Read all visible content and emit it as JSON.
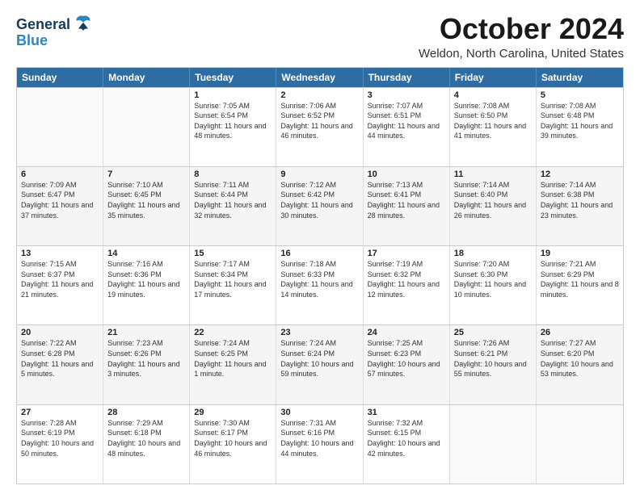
{
  "header": {
    "logo_line1": "General",
    "logo_line2": "Blue",
    "month": "October 2024",
    "location": "Weldon, North Carolina, United States"
  },
  "days_of_week": [
    "Sunday",
    "Monday",
    "Tuesday",
    "Wednesday",
    "Thursday",
    "Friday",
    "Saturday"
  ],
  "weeks": [
    [
      {
        "day": "",
        "text": ""
      },
      {
        "day": "",
        "text": ""
      },
      {
        "day": "1",
        "text": "Sunrise: 7:05 AM\nSunset: 6:54 PM\nDaylight: 11 hours and 48 minutes."
      },
      {
        "day": "2",
        "text": "Sunrise: 7:06 AM\nSunset: 6:52 PM\nDaylight: 11 hours and 46 minutes."
      },
      {
        "day": "3",
        "text": "Sunrise: 7:07 AM\nSunset: 6:51 PM\nDaylight: 11 hours and 44 minutes."
      },
      {
        "day": "4",
        "text": "Sunrise: 7:08 AM\nSunset: 6:50 PM\nDaylight: 11 hours and 41 minutes."
      },
      {
        "day": "5",
        "text": "Sunrise: 7:08 AM\nSunset: 6:48 PM\nDaylight: 11 hours and 39 minutes."
      }
    ],
    [
      {
        "day": "6",
        "text": "Sunrise: 7:09 AM\nSunset: 6:47 PM\nDaylight: 11 hours and 37 minutes."
      },
      {
        "day": "7",
        "text": "Sunrise: 7:10 AM\nSunset: 6:45 PM\nDaylight: 11 hours and 35 minutes."
      },
      {
        "day": "8",
        "text": "Sunrise: 7:11 AM\nSunset: 6:44 PM\nDaylight: 11 hours and 32 minutes."
      },
      {
        "day": "9",
        "text": "Sunrise: 7:12 AM\nSunset: 6:42 PM\nDaylight: 11 hours and 30 minutes."
      },
      {
        "day": "10",
        "text": "Sunrise: 7:13 AM\nSunset: 6:41 PM\nDaylight: 11 hours and 28 minutes."
      },
      {
        "day": "11",
        "text": "Sunrise: 7:14 AM\nSunset: 6:40 PM\nDaylight: 11 hours and 26 minutes."
      },
      {
        "day": "12",
        "text": "Sunrise: 7:14 AM\nSunset: 6:38 PM\nDaylight: 11 hours and 23 minutes."
      }
    ],
    [
      {
        "day": "13",
        "text": "Sunrise: 7:15 AM\nSunset: 6:37 PM\nDaylight: 11 hours and 21 minutes."
      },
      {
        "day": "14",
        "text": "Sunrise: 7:16 AM\nSunset: 6:36 PM\nDaylight: 11 hours and 19 minutes."
      },
      {
        "day": "15",
        "text": "Sunrise: 7:17 AM\nSunset: 6:34 PM\nDaylight: 11 hours and 17 minutes."
      },
      {
        "day": "16",
        "text": "Sunrise: 7:18 AM\nSunset: 6:33 PM\nDaylight: 11 hours and 14 minutes."
      },
      {
        "day": "17",
        "text": "Sunrise: 7:19 AM\nSunset: 6:32 PM\nDaylight: 11 hours and 12 minutes."
      },
      {
        "day": "18",
        "text": "Sunrise: 7:20 AM\nSunset: 6:30 PM\nDaylight: 11 hours and 10 minutes."
      },
      {
        "day": "19",
        "text": "Sunrise: 7:21 AM\nSunset: 6:29 PM\nDaylight: 11 hours and 8 minutes."
      }
    ],
    [
      {
        "day": "20",
        "text": "Sunrise: 7:22 AM\nSunset: 6:28 PM\nDaylight: 11 hours and 5 minutes."
      },
      {
        "day": "21",
        "text": "Sunrise: 7:23 AM\nSunset: 6:26 PM\nDaylight: 11 hours and 3 minutes."
      },
      {
        "day": "22",
        "text": "Sunrise: 7:24 AM\nSunset: 6:25 PM\nDaylight: 11 hours and 1 minute."
      },
      {
        "day": "23",
        "text": "Sunrise: 7:24 AM\nSunset: 6:24 PM\nDaylight: 10 hours and 59 minutes."
      },
      {
        "day": "24",
        "text": "Sunrise: 7:25 AM\nSunset: 6:23 PM\nDaylight: 10 hours and 57 minutes."
      },
      {
        "day": "25",
        "text": "Sunrise: 7:26 AM\nSunset: 6:21 PM\nDaylight: 10 hours and 55 minutes."
      },
      {
        "day": "26",
        "text": "Sunrise: 7:27 AM\nSunset: 6:20 PM\nDaylight: 10 hours and 53 minutes."
      }
    ],
    [
      {
        "day": "27",
        "text": "Sunrise: 7:28 AM\nSunset: 6:19 PM\nDaylight: 10 hours and 50 minutes."
      },
      {
        "day": "28",
        "text": "Sunrise: 7:29 AM\nSunset: 6:18 PM\nDaylight: 10 hours and 48 minutes."
      },
      {
        "day": "29",
        "text": "Sunrise: 7:30 AM\nSunset: 6:17 PM\nDaylight: 10 hours and 46 minutes."
      },
      {
        "day": "30",
        "text": "Sunrise: 7:31 AM\nSunset: 6:16 PM\nDaylight: 10 hours and 44 minutes."
      },
      {
        "day": "31",
        "text": "Sunrise: 7:32 AM\nSunset: 6:15 PM\nDaylight: 10 hours and 42 minutes."
      },
      {
        "day": "",
        "text": ""
      },
      {
        "day": "",
        "text": ""
      }
    ]
  ]
}
